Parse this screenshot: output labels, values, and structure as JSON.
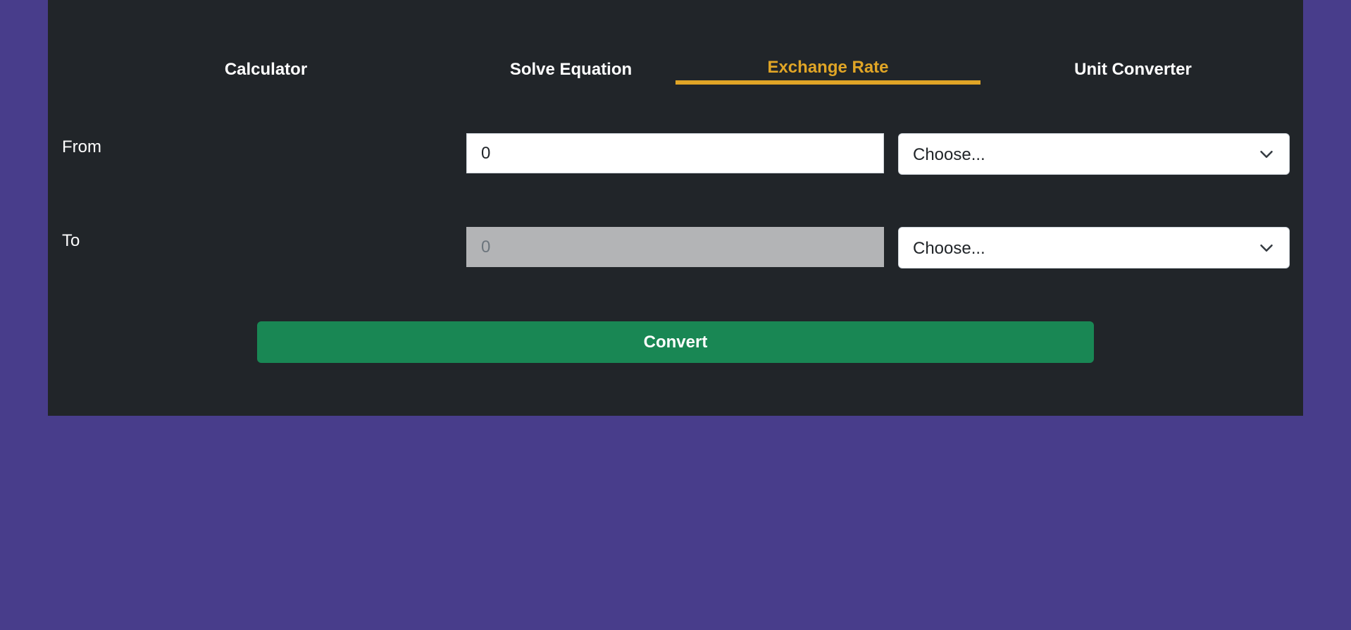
{
  "tabs": [
    {
      "label": "Calculator",
      "active": false
    },
    {
      "label": "Solve Equation",
      "active": false
    },
    {
      "label": "Exchange Rate",
      "active": true
    },
    {
      "label": "Unit Converter",
      "active": false
    }
  ],
  "form": {
    "from": {
      "label": "From",
      "amount": "0",
      "currency_placeholder": "Choose..."
    },
    "to": {
      "label": "To",
      "amount": "0",
      "currency_placeholder": "Choose..."
    },
    "convert_label": "Convert"
  },
  "colors": {
    "page_background": "#483d8b",
    "panel_background": "#212529",
    "active_tab": "#e0a526",
    "convert_button": "#198754",
    "disabled_input": "#b3b4b6"
  },
  "icons": {
    "select_caret": "chevron-down-icon"
  }
}
